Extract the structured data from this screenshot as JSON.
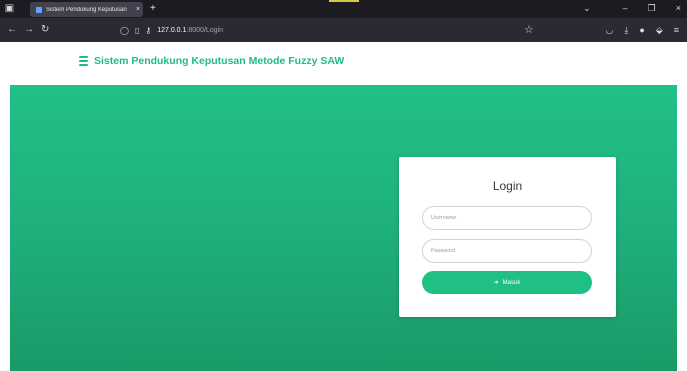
{
  "browser": {
    "tab_title": "Sistem Pendukung Keputusan",
    "tab_close": "×",
    "new_tab": "+",
    "url_host": "127.0.0.1",
    "url_rest": ":8000/Login",
    "window_controls": [
      "⌄",
      "–",
      "❐",
      "×"
    ]
  },
  "header": {
    "brand_title": "Sistem Pendukung Keputusan Metode Fuzzy SAW"
  },
  "login": {
    "title": "Login",
    "username_placeholder": "Username",
    "password_placeholder": "Password",
    "submit_label": "Masuk"
  },
  "colors": {
    "accent": "#1fbd82",
    "hero_top": "#21c087",
    "hero_bottom": "#1a9a68"
  }
}
